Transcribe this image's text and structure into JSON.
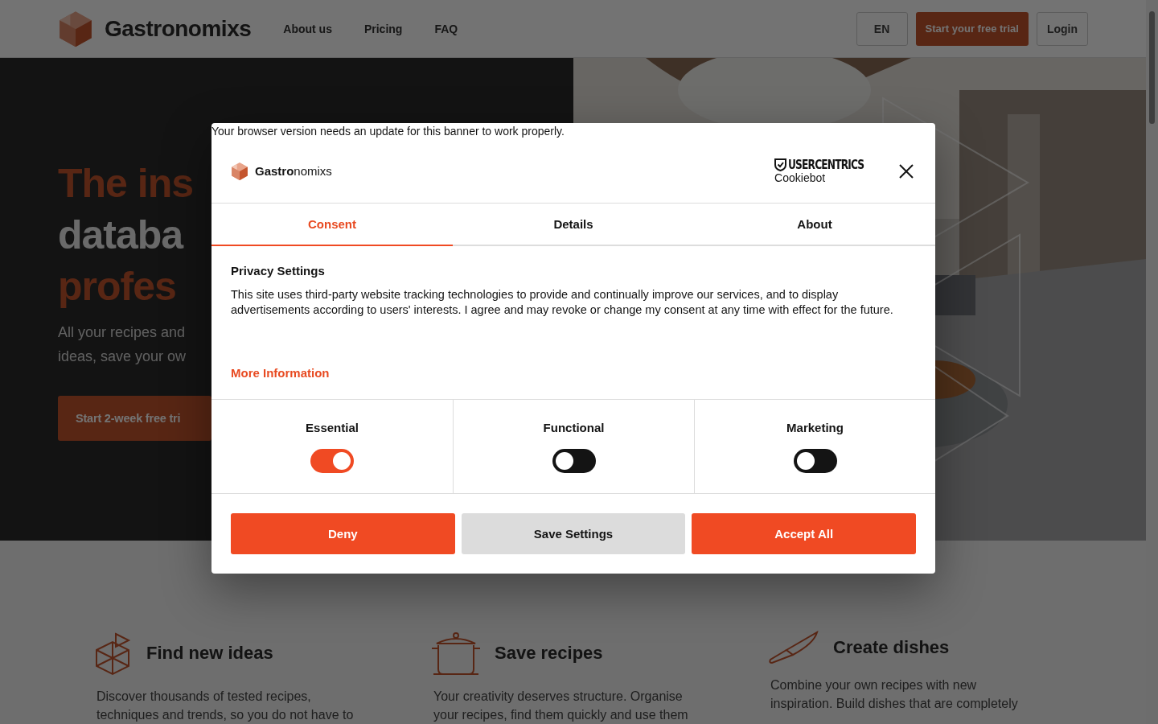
{
  "header": {
    "brand": "Gastronomixs",
    "nav": [
      {
        "label": "About us"
      },
      {
        "label": "Pricing"
      },
      {
        "label": "FAQ"
      }
    ],
    "language": "EN",
    "trial_button": "Start your free trial",
    "login": "Login"
  },
  "hero": {
    "title_lines": [
      {
        "text": "The ins",
        "accent": true
      },
      {
        "text": "databa",
        "accent": false
      },
      {
        "text": "profes",
        "accent": true
      }
    ],
    "subtitle_lines": [
      "All your recipes and",
      "ideas, save your ow"
    ],
    "cta": "Start 2-week free tri"
  },
  "features": [
    {
      "kind": "cube",
      "title": "Find new ideas",
      "lines": [
        "Discover thousands of tested recipes,",
        "techniques and trends, so you do not have to"
      ]
    },
    {
      "kind": "pot",
      "title": "Save recipes",
      "lines": [
        "Your creativity deserves structure. Organise",
        "your recipes, find them quickly and use them"
      ]
    },
    {
      "kind": "knife",
      "title": "Create dishes",
      "lines": [
        "Combine your own recipes with new",
        "inspiration. Build dishes that are completely"
      ]
    }
  ],
  "consent": {
    "browser_notice": "Your browser version needs an update for this banner to work properly.",
    "brand": "**Gastro**nomixs",
    "provider": "USERCENTRICS",
    "provider_sub": "Cookiebot",
    "tabs": [
      {
        "label": "Consent",
        "selected": true
      },
      {
        "label": "Details",
        "selected": false
      },
      {
        "label": "About",
        "selected": false
      }
    ],
    "heading": "Privacy Settings",
    "body": "This site uses third-party website tracking technologies to provide and continually improve our services, and to display advertisements according to users' interests. I agree and may revoke or change my consent at any time with effect for the future.",
    "more_link": "More Information",
    "categories": [
      {
        "label": "Essential",
        "on": true
      },
      {
        "label": "Functional",
        "on": false
      },
      {
        "label": "Marketing",
        "on": false
      }
    ],
    "buttons": [
      {
        "kind": "primary",
        "label": "Deny"
      },
      {
        "kind": "secondary",
        "label": "Save Settings"
      },
      {
        "kind": "primary",
        "label": "Accept All"
      }
    ]
  }
}
